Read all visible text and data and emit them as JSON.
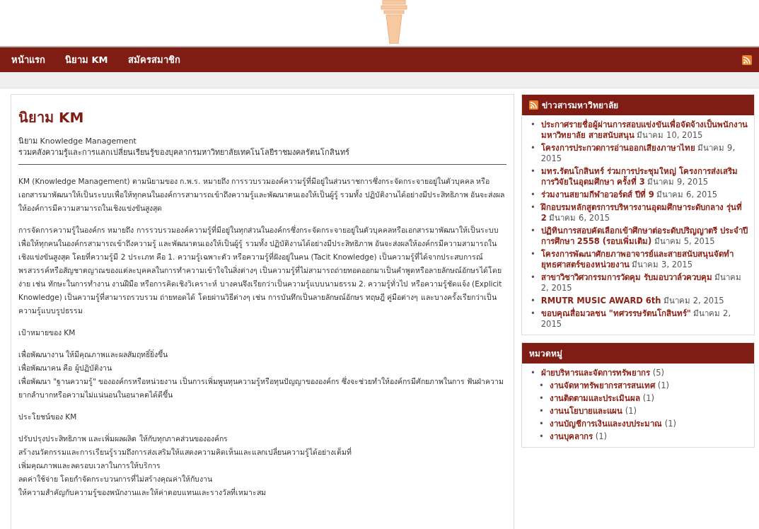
{
  "nav": {
    "items": [
      {
        "label": "หน้าแรก"
      },
      {
        "label": "นิยาม KM"
      },
      {
        "label": "สมัครสมาชิก"
      }
    ]
  },
  "article": {
    "title": "นิยาม KM",
    "subtitle": "นิยาม Knowledge Management",
    "tagline": "รวมคลังความรู้และการแลกเปลี่ยนเรียนรู้ของบุคลากรมหาวิทยาลัยเทคโนโลยีราชมงคลรัตนโกสินทร์",
    "blocks": [
      {
        "kind": "para",
        "text": "KM (Knowledge Management) ตามนิยามของ ก.พ.ร. หมายถึง การรวบรวมองค์ความรู้ที่มีอยู่ในส่วนราชการซึ่งกระจัดกระจายอยู่ในตัวบุคคล หรือเอกสารมาพัฒนาให้เป็นระบบเพื่อให้ทุกคนในองค์การสามารถเข้าถึงความรู้และพัฒนาตนเองให้เป็นผู้รู้ รวมทั้ง ปฏิบัติงานได้อย่างมีประสิทธิภาพ อันจะส่งผลให้องค์การมีความสามารถในเชิงแข่งขันสูงสุด"
      },
      {
        "kind": "para",
        "text": "การจัดการความรู้ในองค์กร หมายถึง การรวบรวมองค์ความรู้ที่มีอยู่ในทุกส่วนในองค์กรซึ่งกระจัดกระจายอยู่ในตัวบุคคลหรือเอกสารมาพัฒนาให้เป็นระบบ เพื่อให้ทุกคนในองค์กรสามารถเข้าถึงความรู้ และพัฒนาตนเองให้เป็นผู้รู้ รวมทั้ง ปฏิบัติงานได้อย่างมีประสิทธิภาพ อันจะส่งผลให้องค์กรมีความสามารถในเชิงแข่งขันสูงสุด โดยที่ความรู้มี 2 ประเภท คือ 1. ความรู้เฉพาะตัว หรือความรู้ที่ฝังอยู่ในคน (Tacit Knowledge) เป็นความรู้ที่ได้จากประสบการณ์ พรสวรรค์หรือสัญชาตญาณของแต่ละบุคคลในการทำความเข้าใจในสิ่งต่างๆ เป็นความรู้ที่ไม่สามารถถ่ายทอดออกมาเป็นคำพูดหรือลายลักษณ์อักษรได้โดยง่าย เช่น ทักษะในการทำงาน งานฝีมือ หรือการคิดเชิงวิเคราะห์ บางคนจึงเรียกว่าเป็นความรู้แบบนามธรรม 2. ความรู้ทั่วไป หรือความรู้ชัดแจ้ง (Explicit Knowledge) เป็นความรู้ที่สามารถรวบรวม ถ่ายทอดได้ โดยผ่านวิธีต่างๆ เช่น การบันทึกเป็นลายลักษณ์อักษร ทฤษฎี คู่มือต่างๆ และบางครั้งเรียกว่าเป็นความรู้แบบรูปธรรม"
      },
      {
        "kind": "heading",
        "text": "เป้าหมายของ KM"
      },
      {
        "kind": "lines",
        "lines": [
          "เพื่อพัฒนางาน ให้มีคุณภาพและผลสัมฤทธิ์ยิ่งขึ้น",
          "เพื่อพัฒนาคน คือ ผู้ปฏิบัติงาน",
          "เพื่อพัฒนา \"ฐานความรู้\" ขององค์กรหรือหน่วยงาน เป็นการเพิ่มพูนทุนความรู้หรือทุนปัญญาขององค์กร ซึ่งจะช่วยทำให้องค์กรมีศักยภาพในการ ฟันฝ่าความยากลำบากหรือความไม่แน่นอนในอนาคตได้ดีขึ้น"
        ]
      },
      {
        "kind": "heading",
        "text": "ประโยชน์ของ KM"
      },
      {
        "kind": "lines",
        "lines": [
          "ปรับปรุงประสิทธิภาพ และเพิ่มผลผลิต ให้กับทุกภาคส่วนขององค์กร",
          "สร้างนวัตกรรมและการเรียนรู้รวมถึงการส่งเสริมให้แสดงความคิดเห็นและแลกเปลี่ยนความรู้ได้อย่างเต็มที่",
          "เพิ่มคุณภาพและลดรอบเวลาในการให้บริการ",
          "ลดค่าใช้จ่าย โดยกำจัดกระบวนการที่ไม่สร้างคุณค่าให้กับงาน",
          "ให้ความสำคัญกับความรู้ของพนักงานและให้ค่าตอบแทนและรางวัลที่เหมาะสม"
        ]
      }
    ]
  },
  "news": {
    "title": "ข่าวสารมหาวิทยาลัย",
    "items": [
      {
        "bullet": "•",
        "title": "ประกาศรายชื่อผู้ผ่านการสอบแข่งขันเพื่อจัดจ้างเป็นพนักงานมหาวิทยาลัย สายสนับสนุน",
        "date": "มีนาคม 10, 2015"
      },
      {
        "bullet": "•",
        "title": "โครงการประกวดการอ่านออกเสียงภาษาไทย",
        "date": "มีนาคม 9, 2015"
      },
      {
        "bullet": "•",
        "title": "มทร.รัตนโกสินทร์ ร่วมการประชุมใหญ่ โครงการส่งเสริมการวิจัยในอุดมศึกษา ครั้งที่ 3",
        "date": "มีนาคม 9, 2015"
      },
      {
        "bullet": "•",
        "title": "ร่วมงานสยามกีฬาอวอร์ดส์ ปีที่ 9",
        "date": "มีนาคม 6, 2015"
      },
      {
        "bullet": "•",
        "title": "ฝึกอบรมหลักสูตรการบริหารงานอุดมศึกษาระดับกลาง รุ่นที่ 2",
        "date": "มีนาคม 6, 2015"
      },
      {
        "bullet": "•",
        "title": "ปฏิทินการสอบคัดเลือกเข้าศึกษาต่อระดับปริญญาตรี ประจำปีการศึกษา 2558 (รอบเพิ่มเติม)",
        "date": "มีนาคม 5, 2015"
      },
      {
        "bullet": "•",
        "title": "โครงการพัฒนาศักยภาพอาจารย์และสายสนับสนุนจัดทำยุทธศาสตร์ของหน่วยงาน",
        "date": "มีนาคม 3, 2015"
      },
      {
        "bullet": "•",
        "title": "สาขาวิชาวิศวกรรมการวัดคุม รับมอบวาล์วควบคุม",
        "date": "มีนาคม 2, 2015"
      },
      {
        "bullet": "•",
        "title": "RMUTR MUSIC AWARD 6th",
        "date": "มีนาคม 2, 2015"
      },
      {
        "bullet": "•",
        "title": "ขอบคุณสื่อมวลชน \"ทศวรรษรัตนโกสินทร์\"",
        "date": "มีนาคม 2, 2015"
      }
    ]
  },
  "categories": {
    "title": "หมวดหมู่",
    "items": [
      {
        "bullet": "•",
        "label": "ฝ่ายบริหารและจัดการทรัพยากร",
        "count": "(5)",
        "children": [
          {
            "bullet": "•",
            "label": "งานจัดหาทรัพยากรสารสนเทศ",
            "count": "(1)"
          },
          {
            "bullet": "•",
            "label": "งานติดตามและประเมินผล",
            "count": "(1)"
          },
          {
            "bullet": "•",
            "label": "งานนโยบายและแผน",
            "count": "(1)"
          },
          {
            "bullet": "•",
            "label": "งานบัญชีการเงินและงบประมาณ",
            "count": "(1)"
          },
          {
            "bullet": "•",
            "label": "งานบุคลากร",
            "count": "(1)"
          }
        ]
      }
    ]
  }
}
